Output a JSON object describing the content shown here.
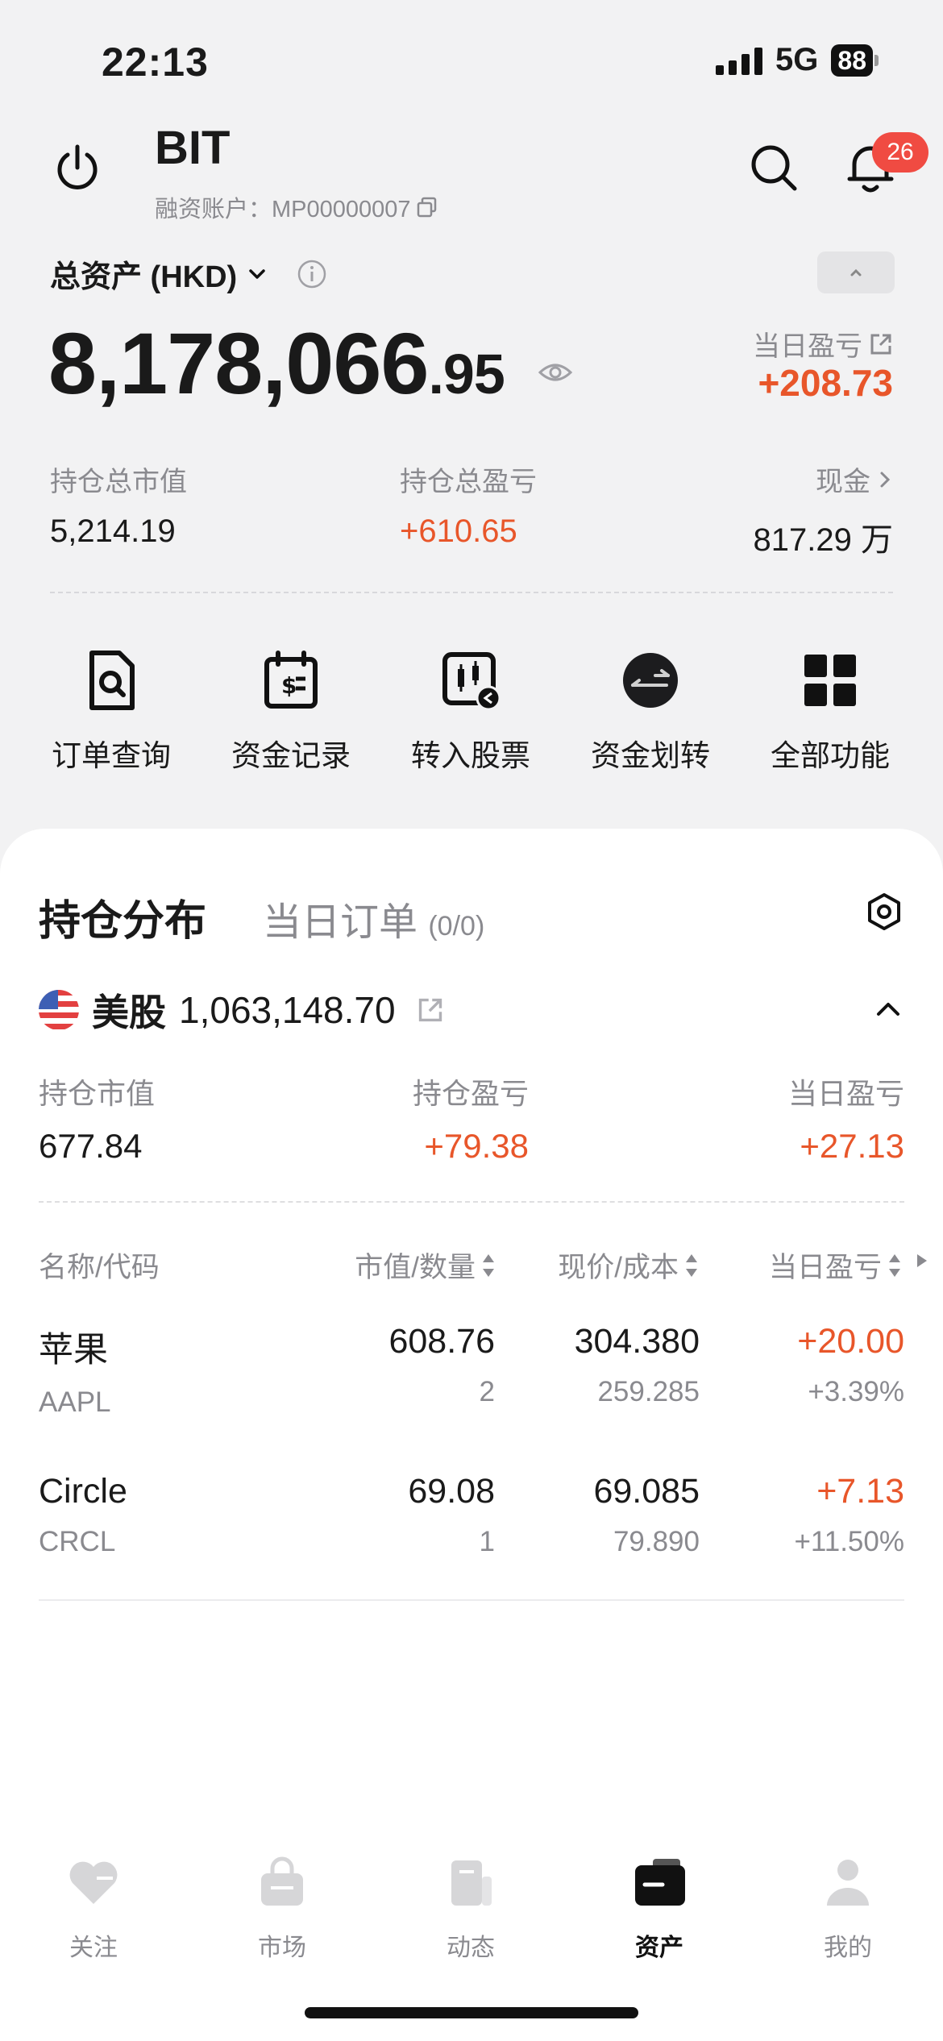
{
  "status_bar": {
    "time": "22:13",
    "network": "5G",
    "battery": "88"
  },
  "header": {
    "account_name": "BIT",
    "account_sub": "融资账户：MP00000007",
    "notification_count": "26"
  },
  "summary": {
    "total_label": "总资产 (HKD)",
    "total_int": "8,178,066",
    "total_dec": ".95",
    "day_pl_label": "当日盈亏",
    "day_pl_value": "+208.73",
    "market_value_label": "持仓总市值",
    "market_value": "5,214.19",
    "total_pl_label": "持仓总盈亏",
    "total_pl": "+610.65",
    "cash_label": "现金",
    "cash": "817.29 万"
  },
  "quick_actions": [
    {
      "label": "订单查询",
      "icon": "order-search-icon"
    },
    {
      "label": "资金记录",
      "icon": "fund-record-icon"
    },
    {
      "label": "转入股票",
      "icon": "transfer-stock-icon"
    },
    {
      "label": "资金划转",
      "icon": "fund-transfer-icon"
    },
    {
      "label": "全部功能",
      "icon": "all-functions-icon"
    }
  ],
  "positions": {
    "tab_active": "持仓分布",
    "tab_inactive": "当日订单",
    "tab_inactive_count": "(0/0)",
    "market_name": "美股",
    "market_total": "1,063,148.70",
    "holding_value_label": "持仓市值",
    "holding_value": "677.84",
    "holding_pl_label": "持仓盈亏",
    "holding_pl": "+79.38",
    "day_pl_label": "当日盈亏",
    "day_pl": "+27.13",
    "columns": [
      "名称/代码",
      "市值/数量",
      "现价/成本",
      "当日盈亏"
    ],
    "rows": [
      {
        "name": "苹果",
        "code": "AAPL",
        "mv": "608.76",
        "qty": "2",
        "price": "304.380",
        "cost": "259.285",
        "pl": "+20.00",
        "pl_pct": "+3.39%"
      },
      {
        "name": "Circle",
        "code": "CRCL",
        "mv": "69.08",
        "qty": "1",
        "price": "69.085",
        "cost": "79.890",
        "pl": "+7.13",
        "pl_pct": "+11.50%"
      }
    ]
  },
  "bottom_nav": [
    {
      "label": "关注"
    },
    {
      "label": "市场"
    },
    {
      "label": "动态"
    },
    {
      "label": "资产"
    },
    {
      "label": "我的"
    }
  ],
  "colors": {
    "gain": "#e8562a",
    "muted": "#8a8a8f",
    "badge": "#f04b42"
  }
}
